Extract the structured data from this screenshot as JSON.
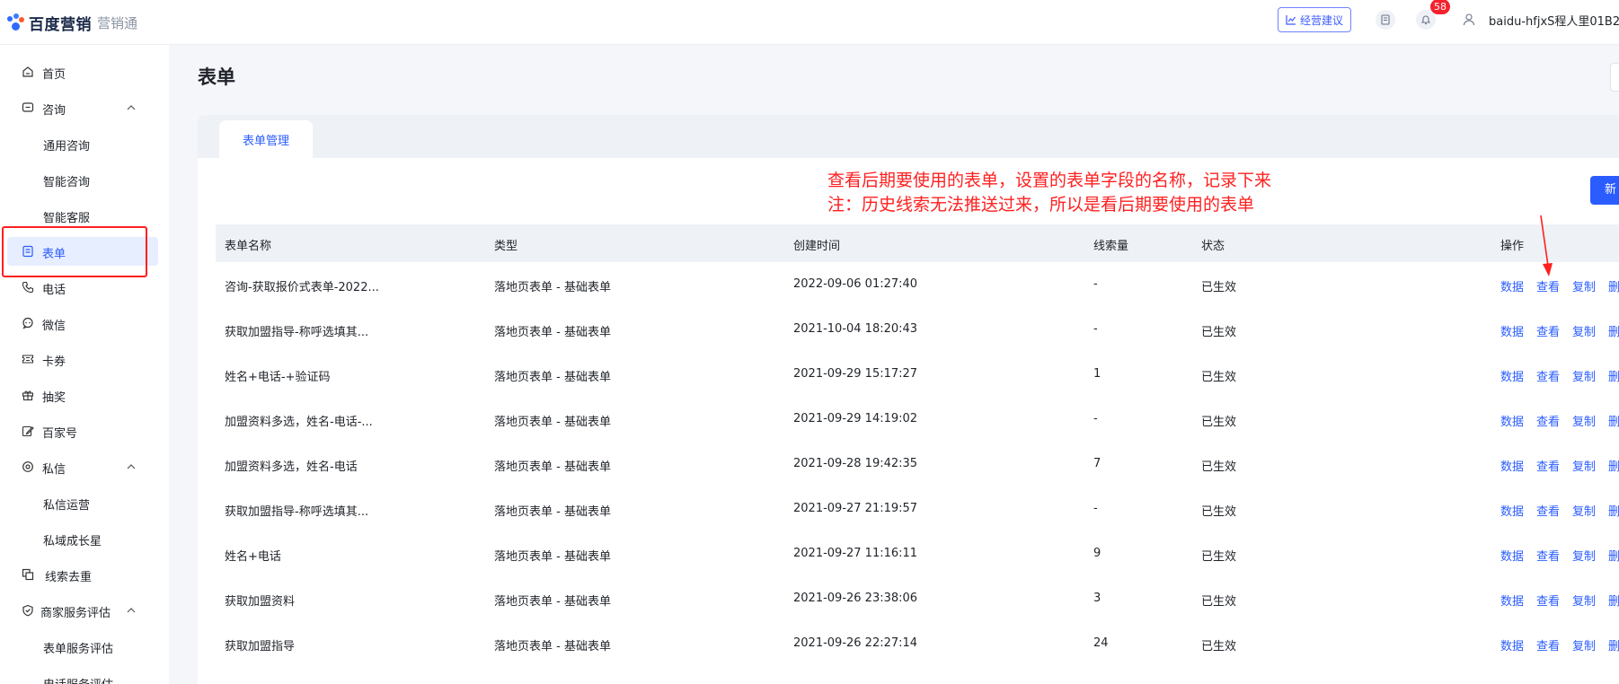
{
  "brand": {
    "name": "百度营销",
    "product": "营销通"
  },
  "header": {
    "advice_label": "经营建议",
    "notification_count": "58",
    "user_name": "baidu-hfjxS程人里01B2"
  },
  "sidebar": {
    "items": [
      {
        "label": "首页",
        "icon": "home-icon"
      },
      {
        "label": "咨询",
        "icon": "chat-icon",
        "expanded": true
      },
      {
        "label": "通用咨询",
        "sub": true
      },
      {
        "label": "智能咨询",
        "sub": true
      },
      {
        "label": "智能客服",
        "sub": true
      },
      {
        "label": "表单",
        "icon": "form-icon",
        "active": true
      },
      {
        "label": "电话",
        "icon": "phone-icon"
      },
      {
        "label": "微信",
        "icon": "wechat-icon"
      },
      {
        "label": "卡券",
        "icon": "coupon-icon"
      },
      {
        "label": "抽奖",
        "icon": "gift-icon"
      },
      {
        "label": "百家号",
        "icon": "edit-icon"
      },
      {
        "label": "私信",
        "icon": "message-icon",
        "expanded": true
      },
      {
        "label": "私信运营",
        "sub": true
      },
      {
        "label": "私域成长星",
        "sub": true
      },
      {
        "label": "线索去重",
        "icon": "dedupe-icon"
      },
      {
        "label": "商家服务评估",
        "icon": "shield-icon",
        "expanded": true
      },
      {
        "label": "表单服务评估",
        "sub": true
      },
      {
        "label": "电话服务评估",
        "sub": true
      }
    ]
  },
  "page": {
    "title": "表单",
    "tab_label": "表单管理",
    "new_button_label": "新",
    "annotation_line1": "查看后期要使用的表单，设置的表单字段的名称，记录下来",
    "annotation_line2": "注：历史线索无法推送过来，所以是看后期要使用的表单"
  },
  "table": {
    "columns": [
      "表单名称",
      "类型",
      "创建时间",
      "线索量",
      "状态",
      "操作"
    ],
    "actions": [
      "数据",
      "查看",
      "复制",
      "删"
    ],
    "rows": [
      {
        "name": "咨询-获取报价式表单-2022...",
        "type": "落地页表单 - 基础表单",
        "created": "2022-09-06 01:27:40",
        "leads": "-",
        "status": "已生效"
      },
      {
        "name": "获取加盟指导-称呼选填其...",
        "type": "落地页表单 - 基础表单",
        "created": "2021-10-04 18:20:43",
        "leads": "-",
        "status": "已生效"
      },
      {
        "name": "姓名+电话-+验证码",
        "type": "落地页表单 - 基础表单",
        "created": "2021-09-29 15:17:27",
        "leads": "1",
        "status": "已生效"
      },
      {
        "name": "加盟资料多选，姓名-电话-...",
        "type": "落地页表单 - 基础表单",
        "created": "2021-09-29 14:19:02",
        "leads": "-",
        "status": "已生效"
      },
      {
        "name": "加盟资料多选，姓名-电话",
        "type": "落地页表单 - 基础表单",
        "created": "2021-09-28 19:42:35",
        "leads": "7",
        "status": "已生效"
      },
      {
        "name": "获取加盟指导-称呼选填其...",
        "type": "落地页表单 - 基础表单",
        "created": "2021-09-27 21:19:57",
        "leads": "-",
        "status": "已生效"
      },
      {
        "name": "姓名+电话",
        "type": "落地页表单 - 基础表单",
        "created": "2021-09-27 11:16:11",
        "leads": "9",
        "status": "已生效"
      },
      {
        "name": "获取加盟资料",
        "type": "落地页表单 - 基础表单",
        "created": "2021-09-26 23:38:06",
        "leads": "3",
        "status": "已生效"
      },
      {
        "name": "获取加盟指导",
        "type": "落地页表单 - 基础表单",
        "created": "2021-09-26 22:27:14",
        "leads": "24",
        "status": "已生效"
      }
    ]
  },
  "colors": {
    "accent": "#2a5cff",
    "annotation": "#ff1f1f",
    "badge": "#f5222d"
  }
}
